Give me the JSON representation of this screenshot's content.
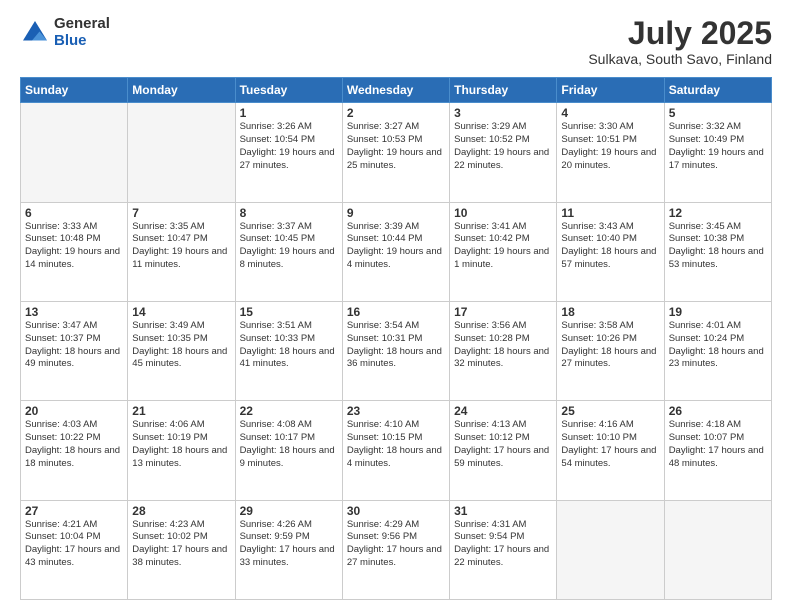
{
  "logo": {
    "general": "General",
    "blue": "Blue"
  },
  "header": {
    "month": "July 2025",
    "location": "Sulkava, South Savo, Finland"
  },
  "weekdays": [
    "Sunday",
    "Monday",
    "Tuesday",
    "Wednesday",
    "Thursday",
    "Friday",
    "Saturday"
  ],
  "weeks": [
    [
      {
        "day": "",
        "info": ""
      },
      {
        "day": "",
        "info": ""
      },
      {
        "day": "1",
        "info": "Sunrise: 3:26 AM\nSunset: 10:54 PM\nDaylight: 19 hours\nand 27 minutes."
      },
      {
        "day": "2",
        "info": "Sunrise: 3:27 AM\nSunset: 10:53 PM\nDaylight: 19 hours\nand 25 minutes."
      },
      {
        "day": "3",
        "info": "Sunrise: 3:29 AM\nSunset: 10:52 PM\nDaylight: 19 hours\nand 22 minutes."
      },
      {
        "day": "4",
        "info": "Sunrise: 3:30 AM\nSunset: 10:51 PM\nDaylight: 19 hours\nand 20 minutes."
      },
      {
        "day": "5",
        "info": "Sunrise: 3:32 AM\nSunset: 10:49 PM\nDaylight: 19 hours\nand 17 minutes."
      }
    ],
    [
      {
        "day": "6",
        "info": "Sunrise: 3:33 AM\nSunset: 10:48 PM\nDaylight: 19 hours\nand 14 minutes."
      },
      {
        "day": "7",
        "info": "Sunrise: 3:35 AM\nSunset: 10:47 PM\nDaylight: 19 hours\nand 11 minutes."
      },
      {
        "day": "8",
        "info": "Sunrise: 3:37 AM\nSunset: 10:45 PM\nDaylight: 19 hours\nand 8 minutes."
      },
      {
        "day": "9",
        "info": "Sunrise: 3:39 AM\nSunset: 10:44 PM\nDaylight: 19 hours\nand 4 minutes."
      },
      {
        "day": "10",
        "info": "Sunrise: 3:41 AM\nSunset: 10:42 PM\nDaylight: 19 hours\nand 1 minute."
      },
      {
        "day": "11",
        "info": "Sunrise: 3:43 AM\nSunset: 10:40 PM\nDaylight: 18 hours\nand 57 minutes."
      },
      {
        "day": "12",
        "info": "Sunrise: 3:45 AM\nSunset: 10:38 PM\nDaylight: 18 hours\nand 53 minutes."
      }
    ],
    [
      {
        "day": "13",
        "info": "Sunrise: 3:47 AM\nSunset: 10:37 PM\nDaylight: 18 hours\nand 49 minutes."
      },
      {
        "day": "14",
        "info": "Sunrise: 3:49 AM\nSunset: 10:35 PM\nDaylight: 18 hours\nand 45 minutes."
      },
      {
        "day": "15",
        "info": "Sunrise: 3:51 AM\nSunset: 10:33 PM\nDaylight: 18 hours\nand 41 minutes."
      },
      {
        "day": "16",
        "info": "Sunrise: 3:54 AM\nSunset: 10:31 PM\nDaylight: 18 hours\nand 36 minutes."
      },
      {
        "day": "17",
        "info": "Sunrise: 3:56 AM\nSunset: 10:28 PM\nDaylight: 18 hours\nand 32 minutes."
      },
      {
        "day": "18",
        "info": "Sunrise: 3:58 AM\nSunset: 10:26 PM\nDaylight: 18 hours\nand 27 minutes."
      },
      {
        "day": "19",
        "info": "Sunrise: 4:01 AM\nSunset: 10:24 PM\nDaylight: 18 hours\nand 23 minutes."
      }
    ],
    [
      {
        "day": "20",
        "info": "Sunrise: 4:03 AM\nSunset: 10:22 PM\nDaylight: 18 hours\nand 18 minutes."
      },
      {
        "day": "21",
        "info": "Sunrise: 4:06 AM\nSunset: 10:19 PM\nDaylight: 18 hours\nand 13 minutes."
      },
      {
        "day": "22",
        "info": "Sunrise: 4:08 AM\nSunset: 10:17 PM\nDaylight: 18 hours\nand 9 minutes."
      },
      {
        "day": "23",
        "info": "Sunrise: 4:10 AM\nSunset: 10:15 PM\nDaylight: 18 hours\nand 4 minutes."
      },
      {
        "day": "24",
        "info": "Sunrise: 4:13 AM\nSunset: 10:12 PM\nDaylight: 17 hours\nand 59 minutes."
      },
      {
        "day": "25",
        "info": "Sunrise: 4:16 AM\nSunset: 10:10 PM\nDaylight: 17 hours\nand 54 minutes."
      },
      {
        "day": "26",
        "info": "Sunrise: 4:18 AM\nSunset: 10:07 PM\nDaylight: 17 hours\nand 48 minutes."
      }
    ],
    [
      {
        "day": "27",
        "info": "Sunrise: 4:21 AM\nSunset: 10:04 PM\nDaylight: 17 hours\nand 43 minutes."
      },
      {
        "day": "28",
        "info": "Sunrise: 4:23 AM\nSunset: 10:02 PM\nDaylight: 17 hours\nand 38 minutes."
      },
      {
        "day": "29",
        "info": "Sunrise: 4:26 AM\nSunset: 9:59 PM\nDaylight: 17 hours\nand 33 minutes."
      },
      {
        "day": "30",
        "info": "Sunrise: 4:29 AM\nSunset: 9:56 PM\nDaylight: 17 hours\nand 27 minutes."
      },
      {
        "day": "31",
        "info": "Sunrise: 4:31 AM\nSunset: 9:54 PM\nDaylight: 17 hours\nand 22 minutes."
      },
      {
        "day": "",
        "info": ""
      },
      {
        "day": "",
        "info": ""
      }
    ]
  ]
}
